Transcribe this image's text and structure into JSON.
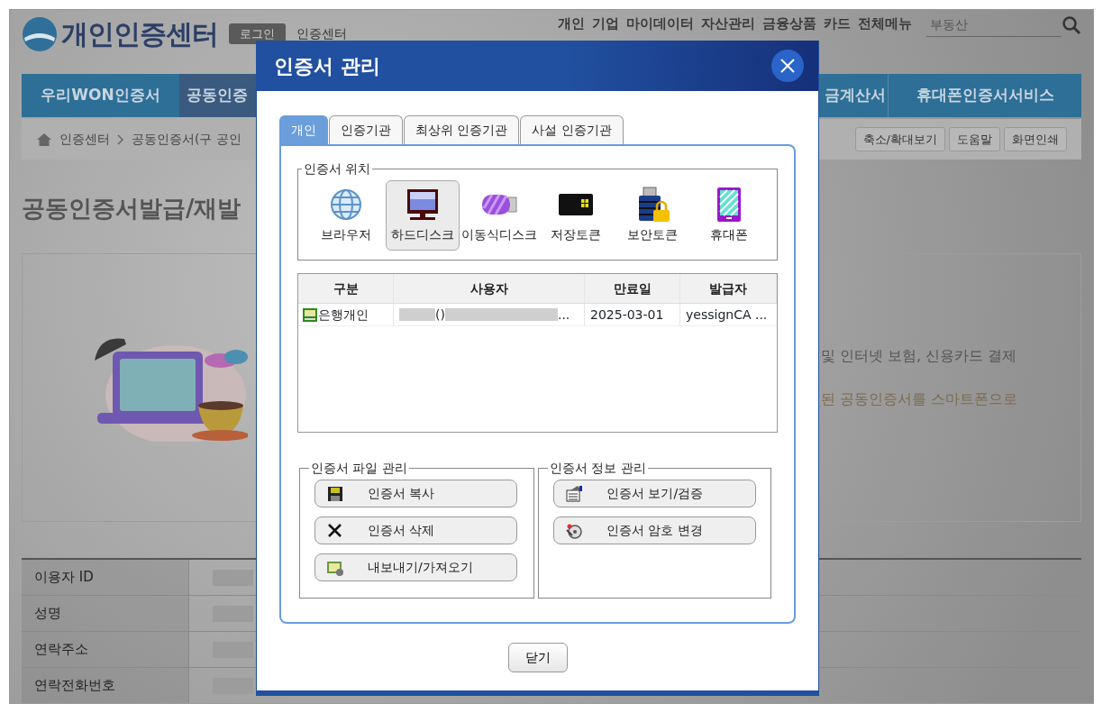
{
  "site": {
    "logo": "개인인증센터",
    "login_button": "로그인",
    "section_label": "인증센터"
  },
  "top_nav": [
    {
      "label": "개인"
    },
    {
      "label": "기업"
    },
    {
      "label": "마이데이터"
    },
    {
      "label": "자산관리"
    },
    {
      "label": "금융상품"
    },
    {
      "label": "카드"
    },
    {
      "label": "전체메뉴"
    }
  ],
  "search": {
    "placeholder": "부동산"
  },
  "menu": [
    {
      "label": "우리WON인증서",
      "selected": false
    },
    {
      "label": "공동인증",
      "selected": true
    },
    {
      "label": "금계산서",
      "selected": false
    },
    {
      "label": "휴대폰인증서서비스",
      "selected": false
    }
  ],
  "breadcrumb": [
    "인증센터",
    "공동인증서(구 공인"
  ],
  "page_tools": [
    "축소/확대보기",
    "도움말",
    "화면인쇄"
  ],
  "page_title": "공동인증서발급/재발",
  "intro_lines": [
    {
      "text": "및 인터넷 보험, 신용카드 결제",
      "kind": "plain"
    },
    {
      "text": "된 공동인증서를 스마트폰으로",
      "kind": "accent"
    }
  ],
  "user_info": [
    {
      "label": "이용자 ID"
    },
    {
      "label": "성명"
    },
    {
      "label": "연락주소"
    },
    {
      "label": "연락전화번호"
    }
  ],
  "dialog": {
    "title": "인증서 관리",
    "tabs": [
      {
        "label": "개인",
        "selected": true
      },
      {
        "label": "인증기관",
        "selected": false
      },
      {
        "label": "최상위 인증기관",
        "selected": false
      },
      {
        "label": "사설 인증기관",
        "selected": false
      }
    ],
    "location_label": "인증서 위치",
    "locations": [
      {
        "label": "브라우저",
        "selected": false
      },
      {
        "label": "하드디스크",
        "selected": true
      },
      {
        "label": "이동식디스크",
        "selected": false
      },
      {
        "label": "저장토큰",
        "selected": false
      },
      {
        "label": "보안토큰",
        "selected": false
      },
      {
        "label": "휴대폰",
        "selected": false
      }
    ],
    "table": {
      "columns": [
        "구분",
        "사용자",
        "만료일",
        "발급자"
      ],
      "rows": [
        {
          "type": "은행개인",
          "user": "()",
          "user_tail": "...",
          "expiry": "2025-03-01",
          "issuer": "yessignCA ..."
        }
      ]
    },
    "file_group": {
      "label": "인증서 파일 관리",
      "buttons": [
        "인증서 복사",
        "인증서 삭제",
        "내보내기/가져오기"
      ]
    },
    "info_group": {
      "label": "인증서 정보 관리",
      "buttons": [
        "인증서 보기/검증",
        "인증서 암호 변경"
      ]
    },
    "close_button": "닫기"
  }
}
